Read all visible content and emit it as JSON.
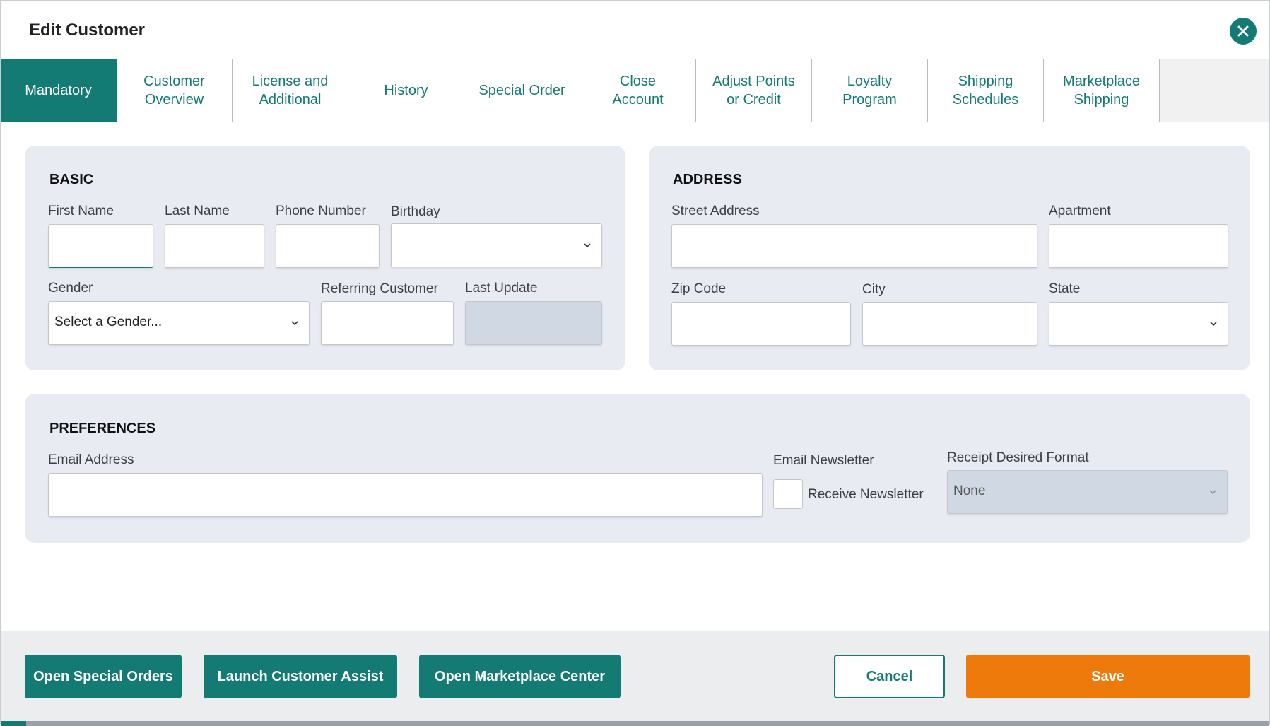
{
  "dialog": {
    "title": "Edit Customer"
  },
  "icons": {
    "close": "close-icon",
    "chevron": "chevron-down-icon"
  },
  "colors": {
    "accent": "#137a74",
    "save": "#ee7a0c",
    "panel": "#e8ebf2"
  },
  "tabs": [
    {
      "label": "Mandatory",
      "active": true
    },
    {
      "label": "Customer\nOverview"
    },
    {
      "label": "License and\nAdditional"
    },
    {
      "label": "History"
    },
    {
      "label": "Special Order"
    },
    {
      "label": "Close\nAccount"
    },
    {
      "label": "Adjust Points\nor Credit"
    },
    {
      "label": "Loyalty\nProgram"
    },
    {
      "label": "Shipping\nSchedules"
    },
    {
      "label": "Marketplace\nShipping"
    }
  ],
  "basic": {
    "title": "BASIC",
    "first_name": {
      "label": "First Name",
      "value": ""
    },
    "last_name": {
      "label": "Last Name",
      "value": ""
    },
    "phone": {
      "label": "Phone Number",
      "value": ""
    },
    "birthday": {
      "label": "Birthday",
      "value": ""
    },
    "gender": {
      "label": "Gender",
      "value": "Select a Gender..."
    },
    "referring": {
      "label": "Referring Customer",
      "value": ""
    },
    "last_update": {
      "label": "Last Update",
      "value": ""
    }
  },
  "address": {
    "title": "ADDRESS",
    "street": {
      "label": "Street Address",
      "value": ""
    },
    "apartment": {
      "label": "Apartment",
      "value": ""
    },
    "zip": {
      "label": "Zip Code",
      "value": ""
    },
    "city": {
      "label": "City",
      "value": ""
    },
    "state": {
      "label": "State",
      "value": ""
    }
  },
  "preferences": {
    "title": "PREFERENCES",
    "email": {
      "label": "Email Address",
      "value": ""
    },
    "newsletter": {
      "label": "Email Newsletter",
      "checkbox_label": "Receive Newsletter",
      "checked": false
    },
    "receipt_format": {
      "label": "Receipt Desired Format",
      "value": "None"
    }
  },
  "footer": {
    "open_special_orders": "Open Special Orders",
    "launch_customer_assist": "Launch Customer Assist",
    "open_marketplace_center": "Open Marketplace Center",
    "cancel": "Cancel",
    "save": "Save"
  }
}
